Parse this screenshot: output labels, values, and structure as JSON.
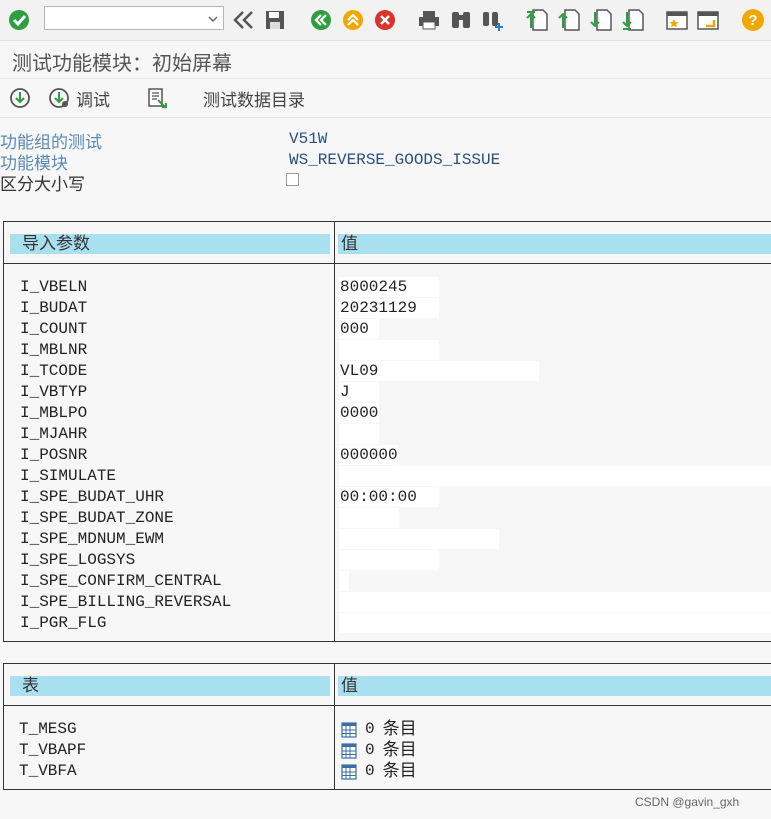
{
  "toolbar": {
    "command_field": {
      "value": "",
      "placeholder": ""
    },
    "icons": [
      "enter-icon",
      "back-icon",
      "save-icon",
      "back-nav-icon",
      "exit-icon",
      "cancel-icon",
      "print-icon",
      "find-icon",
      "find-next-icon",
      "first-page-icon",
      "prev-page-icon",
      "next-page-icon",
      "last-page-icon",
      "bookmark-icon",
      "new-session-icon",
      "help-icon"
    ]
  },
  "title": "测试功能模块：初始屏幕",
  "app_toolbar": {
    "execute_label": "",
    "debug_label": "调试",
    "test_data_dir_label": "测试数据目录"
  },
  "fields": {
    "fg_label": "功能组的测试",
    "fg_value": "V51W",
    "fm_label": "功能模块",
    "fm_value": "WS_REVERSE_GOODS_ISSUE",
    "case_label": "区分大小写",
    "case_checked": false
  },
  "import_params": {
    "header_param": "导入参数",
    "header_value": "值",
    "rows": [
      {
        "name": "I_VBELN",
        "value": "8000245"
      },
      {
        "name": "I_BUDAT",
        "value": "20231129"
      },
      {
        "name": "I_COUNT",
        "value": "000"
      },
      {
        "name": "I_MBLNR",
        "value": ""
      },
      {
        "name": "I_TCODE",
        "value": "VL09"
      },
      {
        "name": "I_VBTYP",
        "value": "J"
      },
      {
        "name": "I_MBLPO",
        "value": "0000"
      },
      {
        "name": "I_MJAHR",
        "value": ""
      },
      {
        "name": "I_POSNR",
        "value": "000000"
      },
      {
        "name": "I_SIMULATE",
        "value": ""
      },
      {
        "name": "I_SPE_BUDAT_UHR",
        "value": "00:00:00"
      },
      {
        "name": "I_SPE_BUDAT_ZONE",
        "value": ""
      },
      {
        "name": "I_SPE_MDNUM_EWM",
        "value": ""
      },
      {
        "name": "I_SPE_LOGSYS",
        "value": ""
      },
      {
        "name": "I_SPE_CONFIRM_CENTRAL",
        "value": ""
      },
      {
        "name": "I_SPE_BILLING_REVERSAL",
        "value": ""
      },
      {
        "name": "I_PGR_FLG",
        "value": ""
      }
    ]
  },
  "tables": {
    "header_param": "表",
    "header_value": "值",
    "entry_suffix": "条目",
    "rows": [
      {
        "name": "T_MESG",
        "count": "0"
      },
      {
        "name": "T_VBAPF",
        "count": "0"
      },
      {
        "name": "T_VBFA",
        "count": "0"
      }
    ]
  },
  "watermark": "CSDN @gavin_gxh",
  "colors": {
    "header_bg": "#a8e0f0",
    "label_blue": "#5b8ab3",
    "value_blue": "#2b4f7a",
    "ok_green": "#2e9e3e",
    "cancel_red": "#d9332b",
    "warn_orange": "#f0a800"
  }
}
